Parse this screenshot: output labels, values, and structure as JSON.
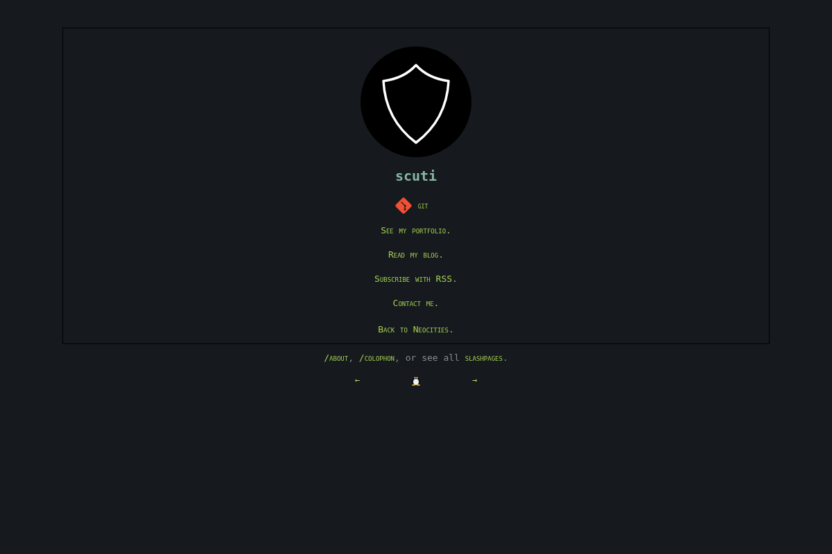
{
  "site_title": "scuti",
  "links": [
    {
      "kind": "git",
      "label": "git"
    },
    {
      "kind": "text",
      "label": "See my portfolio."
    },
    {
      "kind": "text",
      "label": "Read my blog."
    },
    {
      "kind": "text",
      "label": "Subscribe with RSS."
    },
    {
      "kind": "text",
      "label": "Contact me."
    }
  ],
  "back_link": "Back to Neocities.",
  "slashpages_line": [
    {
      "kind": "link",
      "text": "/about"
    },
    {
      "kind": "plain",
      "text": ", "
    },
    {
      "kind": "link",
      "text": "/colophon"
    },
    {
      "kind": "plain",
      "text": ", or see all "
    },
    {
      "kind": "link",
      "text": "slashpages"
    },
    {
      "kind": "plain",
      "text": "."
    }
  ],
  "webring": {
    "previous": "←",
    "next": "→"
  }
}
